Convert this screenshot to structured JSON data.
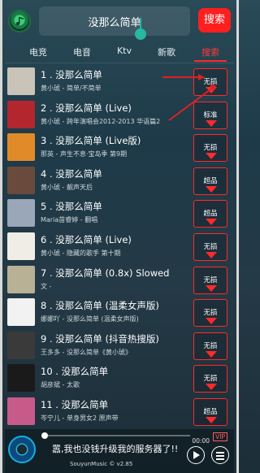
{
  "search": {
    "query": "没那么简单",
    "button_label": "搜索"
  },
  "tabs": [
    "电竞",
    "电音",
    "Ktv",
    "新歌",
    "搜索"
  ],
  "songs": [
    {
      "title": "1 . 没那么简单",
      "subtitle": "黄小琥 - 简单/不简单",
      "quality": "无损",
      "cover": "#c9c3b8"
    },
    {
      "title": "2 . 没那么简单 (Live)",
      "subtitle": "黄小琥 - 跨年演唱会2012-2013 华语篇2",
      "quality": "标准",
      "cover": "#b3262e"
    },
    {
      "title": "3 . 没那么简单 (Live版)",
      "subtitle": "那英 - 声生不息·宝岛季 第9期",
      "quality": "无损",
      "cover": "#e08a2a"
    },
    {
      "title": "4 . 没那么简单",
      "subtitle": "黄小琥 - 靓声天后",
      "quality": "超品",
      "cover": "#6a4a3c"
    },
    {
      "title": "5 . 没那么简单",
      "subtitle": "Maria苗睿婷 - 翻唱",
      "quality": "超品",
      "cover": "#9aa7b8"
    },
    {
      "title": "6 . 没那么简单 (Live)",
      "subtitle": "黄小琥 - 隐藏的歌手 第十期",
      "quality": "无损",
      "cover": "#f0ede6"
    },
    {
      "title": "7 . 没那么简单 (0.8x) Slowed",
      "subtitle": "文 -",
      "quality": "无损",
      "cover": "#b8b196"
    },
    {
      "title": "8 . 没那么简单 (温柔女声版)",
      "subtitle": "娜娜吖 - 没那么简单 (温柔女声版)",
      "quality": "无损",
      "cover": "#f2f2f2"
    },
    {
      "title": "9 . 没那么简单 (抖音热搜版)",
      "subtitle": "王多多 - 没那么简单《黄小琥》",
      "quality": "无损",
      "cover": "#3a3a3a"
    },
    {
      "title": "10 . 没那么简单",
      "subtitle": "胡彦斌 - 太歌",
      "quality": "无损",
      "cover": "#1a1a1a"
    },
    {
      "title": "11 . 没那么简单",
      "subtitle": "岑宁儿 - 单身男女2 原声带",
      "quality": "超品",
      "cover": "#c85a8a"
    }
  ],
  "player": {
    "now_playing": "嚣,我也没钱升级我的服务器了!!",
    "version": "SouyunMusic © v2.85",
    "time": "00:00",
    "vip_badge": "VIP",
    "progress": 0.0
  },
  "colors": {
    "accent": "#ff2a2a",
    "teal": "#26b8a0",
    "search_button": "#ff1f1f"
  }
}
